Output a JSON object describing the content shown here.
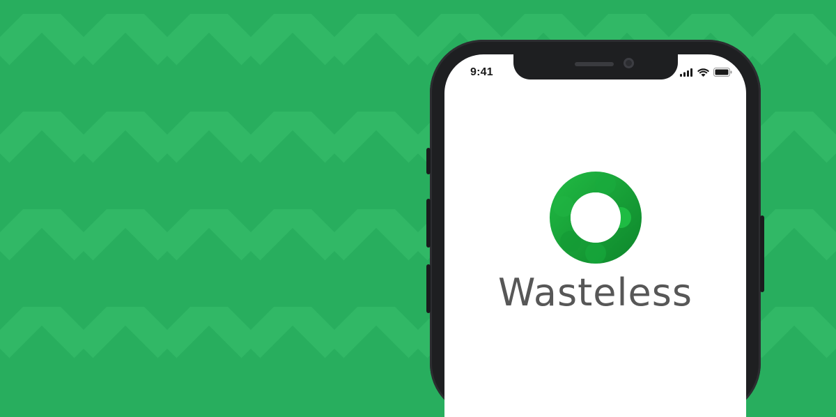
{
  "status_bar": {
    "time": "9:41"
  },
  "brand": {
    "name": "Wasteless"
  },
  "icons": {
    "signal": "cellular-signal-icon",
    "wifi": "wifi-icon",
    "battery": "battery-icon",
    "logo": "wasteless-logo-ring"
  },
  "colors": {
    "background": "#28ae5e",
    "pattern_light": "#31b866",
    "logo_green": "#1db33f",
    "logo_dark": "#139431",
    "brand_text": "#575757"
  }
}
